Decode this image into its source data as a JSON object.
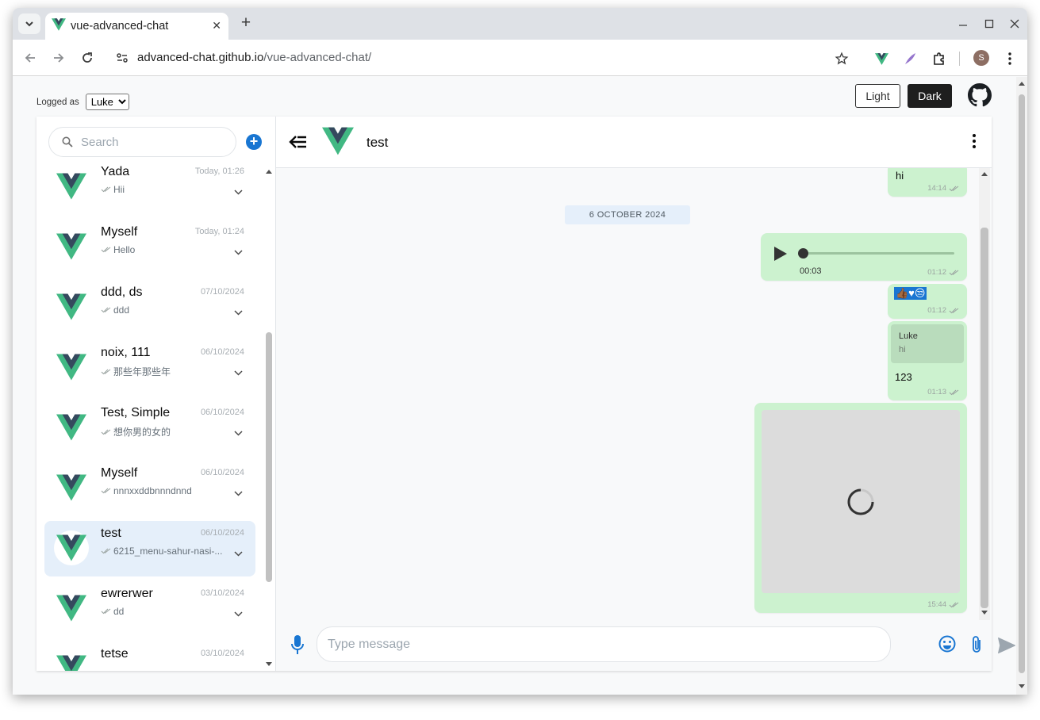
{
  "browser": {
    "tab_title": "vue-advanced-chat",
    "url_host": "advanced-chat.github.io",
    "url_path": "/vue-advanced-chat/",
    "profile_initial": "S"
  },
  "page": {
    "logged_as_label": "Logged as",
    "logged_user": "Luke",
    "light_button": "Light",
    "dark_button": "Dark"
  },
  "rooms_panel": {
    "search_placeholder": "Search",
    "rooms": [
      {
        "name": "Yada",
        "date": "Today, 01:26",
        "last_message": "Hii"
      },
      {
        "name": "Myself",
        "date": "Today, 01:24",
        "last_message": "Hello"
      },
      {
        "name": "ddd, ds",
        "date": "07/10/2024",
        "last_message": "ddd"
      },
      {
        "name": "noix, 111",
        "date": "06/10/2024",
        "last_message": "那些年那些年"
      },
      {
        "name": "Test, Simple",
        "date": "06/10/2024",
        "last_message": "想你男的女的"
      },
      {
        "name": "Myself",
        "date": "06/10/2024",
        "last_message": "nnnxxddbnnndnnd"
      },
      {
        "name": "test",
        "date": "06/10/2024",
        "last_message": "6215_menu-sahur-nasi-..."
      },
      {
        "name": "ewrerwer",
        "date": "03/10/2024",
        "last_message": "dd"
      },
      {
        "name": "tetse",
        "date": "03/10/2024",
        "last_message": ""
      }
    ]
  },
  "room_header": {
    "name": "test"
  },
  "messages": {
    "first": {
      "text": "hi",
      "time": "14:14"
    },
    "date_separator": "6 OCTOBER 2024",
    "audio": {
      "duration": "00:03",
      "time": "01:12",
      "progress": 0
    },
    "emoji": {
      "text": "👍🏾♥😒",
      "time": "01:12"
    },
    "reply": {
      "reply_author": "Luke",
      "reply_text": "hi",
      "text": "123",
      "time": "01:13"
    },
    "image": {
      "time": "15:44"
    }
  },
  "footer": {
    "input_placeholder": "Type message"
  },
  "colors": {
    "accent": "#1976d2",
    "bubble": "#ccf2cf",
    "active_room": "#e5effa",
    "vue_green": "#41b883",
    "vue_dark": "#35495e"
  }
}
